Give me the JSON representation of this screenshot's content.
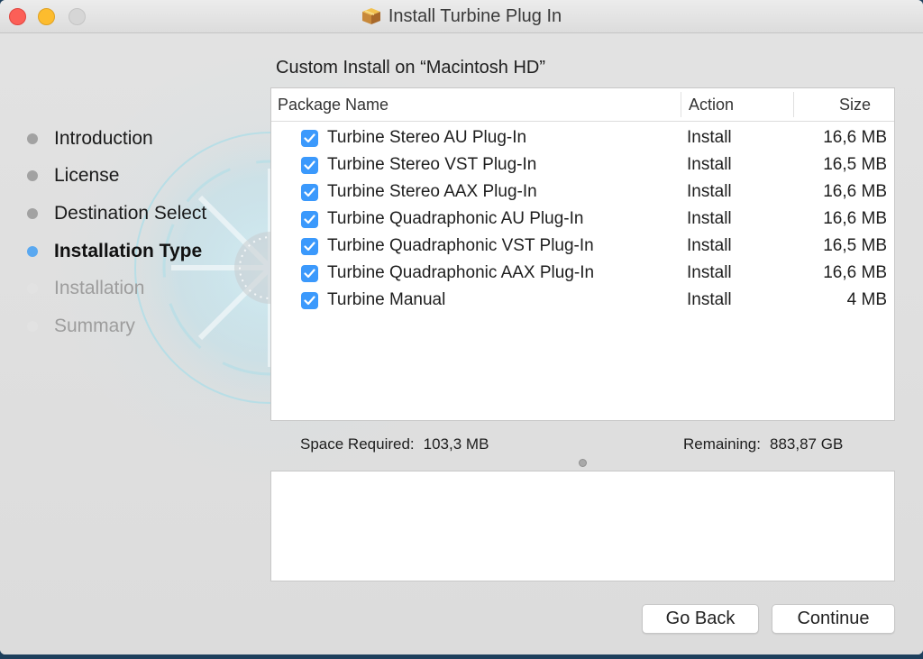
{
  "window": {
    "title": "Install Turbine Plug In",
    "title_icon": "package-icon"
  },
  "sidebar": {
    "steps": [
      {
        "label": "Introduction",
        "state": "done"
      },
      {
        "label": "License",
        "state": "done"
      },
      {
        "label": "Destination Select",
        "state": "done"
      },
      {
        "label": "Installation Type",
        "state": "active"
      },
      {
        "label": "Installation",
        "state": "future"
      },
      {
        "label": "Summary",
        "state": "future"
      }
    ]
  },
  "main": {
    "heading": "Custom Install on “Macintosh HD”",
    "table": {
      "columns": {
        "name": "Package Name",
        "action": "Action",
        "size": "Size"
      },
      "rows": [
        {
          "name": "Turbine Stereo AU Plug-In",
          "checked": true,
          "action": "Install",
          "size": "16,6 MB"
        },
        {
          "name": "Turbine Stereo VST Plug-In",
          "checked": true,
          "action": "Install",
          "size": "16,5 MB"
        },
        {
          "name": "Turbine Stereo AAX Plug-In",
          "checked": true,
          "action": "Install",
          "size": "16,6 MB"
        },
        {
          "name": "Turbine Quadraphonic AU Plug-In",
          "checked": true,
          "action": "Install",
          "size": "16,6 MB"
        },
        {
          "name": "Turbine Quadraphonic VST Plug-In",
          "checked": true,
          "action": "Install",
          "size": "16,5 MB"
        },
        {
          "name": "Turbine Quadraphonic AAX Plug-In",
          "checked": true,
          "action": "Install",
          "size": "16,6 MB"
        },
        {
          "name": "Turbine Manual",
          "checked": true,
          "action": "Install",
          "size": "4 MB"
        }
      ]
    },
    "space_required_label": "Space Required:",
    "space_required_value": "103,3 MB",
    "remaining_label": "Remaining:",
    "remaining_value": "883,87 GB",
    "description": ""
  },
  "buttons": {
    "go_back": "Go Back",
    "continue": "Continue"
  },
  "colors": {
    "accent": "#3b99fc",
    "active_step_dot": "#5aa8f0",
    "close": "#fc5f57",
    "minimize": "#fdbc2e"
  }
}
